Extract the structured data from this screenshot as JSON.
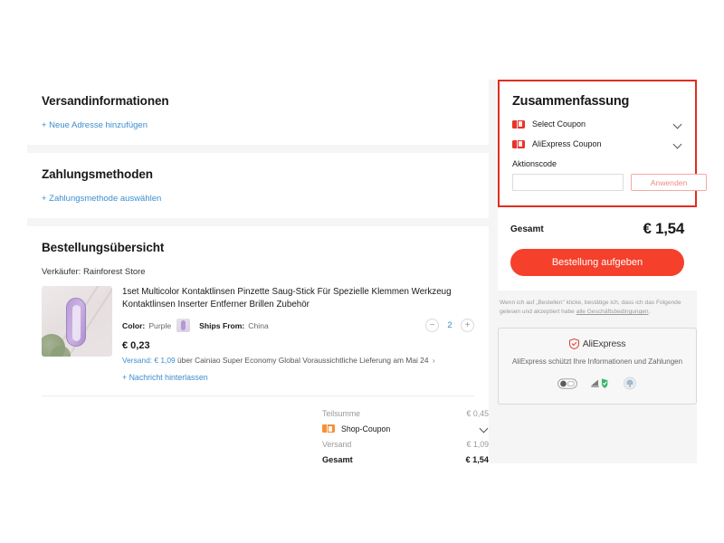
{
  "colors": {
    "accent_red": "#f5402c",
    "highlight_border": "#e02d20",
    "link_blue": "#3b8ed0",
    "coupon_orange": "#f39237",
    "page_bg": "#f5f5f5"
  },
  "shipping_section": {
    "title": "Versandinformationen",
    "add_address_link": "+ Neue Adresse hinzufügen"
  },
  "payment_section": {
    "title": "Zahlungsmethoden",
    "add_payment_link": "+ Zahlungsmethode auswählen"
  },
  "order_section": {
    "title": "Bestellungsübersicht",
    "seller": "Verkäufer: Rainforest Store",
    "item": {
      "title": "1set Multicolor Kontaktlinsen Pinzette Saug-Stick Für Spezielle Klemmen Werkzeug Kontaktlinsen Inserter Entferner Brillen Zubehör",
      "color_label": "Color:",
      "color_value": "Purple",
      "ships_from_label": "Ships From:",
      "ships_from_value": "China",
      "quantity": "2",
      "decrease_label": "−",
      "increase_label": "+",
      "price": "€ 0,23",
      "shipping_label": "Versand:",
      "shipping_cost": "€ 1,09",
      "shipping_via": "über Cainiao Super Economy Global",
      "delivery_estimate": "Voraussichtliche Lieferung am Mai 24",
      "chevron": "›",
      "leave_message_link": "+ Nachricht hinterlassen"
    },
    "totals": [
      {
        "label": "Teilsumme",
        "value": "€ 0,45",
        "type": "plain"
      },
      {
        "label": "Shop-Coupon",
        "value": "",
        "type": "coupon"
      },
      {
        "label": "Versand",
        "value": "€ 1,09",
        "type": "plain"
      },
      {
        "label": "Gesamt",
        "value": "€ 1,54",
        "type": "bold"
      }
    ]
  },
  "summary": {
    "title": "Zusammenfassung",
    "coupons": [
      {
        "label": "Select Coupon"
      },
      {
        "label": "AliExpress Coupon"
      }
    ],
    "promo_label": "Aktionscode",
    "promo_value": "",
    "promo_placeholder": "",
    "apply_button": "Anwenden",
    "total_label": "Gesamt",
    "total_value": "€ 1,54",
    "place_order_button": "Bestellung aufgeben",
    "disclaimer_text": "Wenn ich auf „Bestellen\" klicke, bestätige ich, dass ich das Folgende gelesen und akzeptiert habe ",
    "disclaimer_link": "alle Geschäftsbedingungen",
    "disclaimer_end": "."
  },
  "protection": {
    "brand": "AliExpress",
    "text": "AliExpress schützt Ihre Informationen und Zahlungen"
  }
}
